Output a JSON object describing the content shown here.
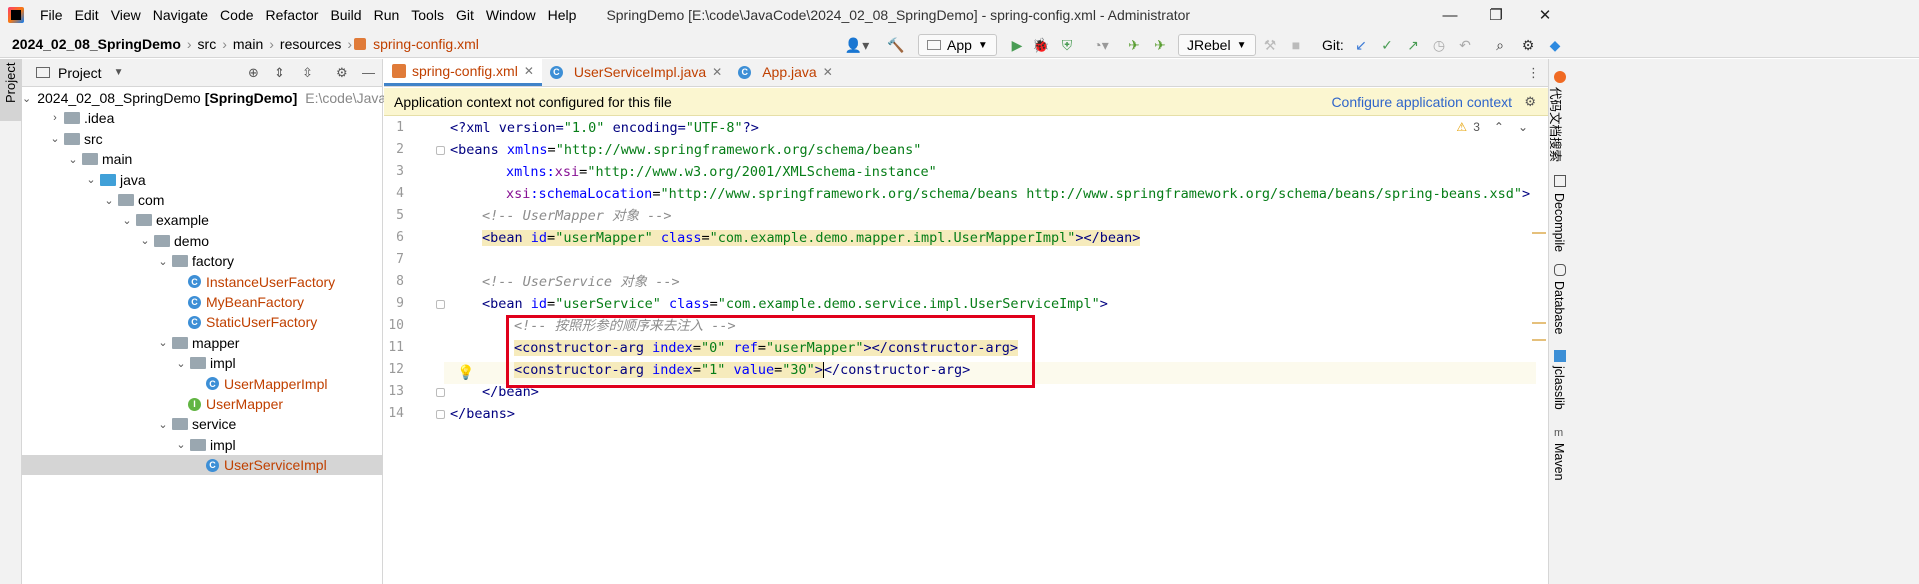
{
  "menubar": {
    "items": [
      "File",
      "Edit",
      "View",
      "Navigate",
      "Code",
      "Refactor",
      "Build",
      "Run",
      "Tools",
      "Git",
      "Window",
      "Help"
    ],
    "title": "SpringDemo [E:\\code\\JavaCode\\2024_02_08_SpringDemo] - spring-config.xml - Administrator"
  },
  "breadcrumb": [
    "2024_02_08_SpringDemo",
    "src",
    "main",
    "resources",
    "spring-config.xml"
  ],
  "toolbar": {
    "run_config": "App",
    "jrebel": "JRebel",
    "git_label": "Git:"
  },
  "left_strip": {
    "project_tab": "Project"
  },
  "project_panel": {
    "title": "Project",
    "tree": [
      {
        "label": "2024_02_08_SpringDemo",
        "bold": "[SpringDemo]",
        "path": "E:\\code\\Java",
        "depth": 0,
        "type": "module",
        "expanded": true
      },
      {
        "label": ".idea",
        "depth": 1,
        "type": "folder",
        "expanded": false
      },
      {
        "label": "src",
        "depth": 1,
        "type": "folder",
        "expanded": true
      },
      {
        "label": "main",
        "depth": 2,
        "type": "folder",
        "expanded": true
      },
      {
        "label": "java",
        "depth": 3,
        "type": "source",
        "expanded": true
      },
      {
        "label": "com",
        "depth": 4,
        "type": "folder",
        "expanded": true
      },
      {
        "label": "example",
        "depth": 5,
        "type": "folder",
        "expanded": true
      },
      {
        "label": "demo",
        "depth": 6,
        "type": "folder",
        "expanded": true
      },
      {
        "label": "factory",
        "depth": 7,
        "type": "folder",
        "expanded": true
      },
      {
        "label": "InstanceUserFactory",
        "depth": 8,
        "type": "class"
      },
      {
        "label": "MyBeanFactory",
        "depth": 8,
        "type": "class"
      },
      {
        "label": "StaticUserFactory",
        "depth": 8,
        "type": "class"
      },
      {
        "label": "mapper",
        "depth": 7,
        "type": "folder",
        "expanded": true
      },
      {
        "label": "impl",
        "depth": 8,
        "type": "folder",
        "expanded": true
      },
      {
        "label": "UserMapperImpl",
        "depth": 9,
        "type": "class"
      },
      {
        "label": "UserMapper",
        "depth": 8,
        "type": "interface"
      },
      {
        "label": "service",
        "depth": 7,
        "type": "folder",
        "expanded": true
      },
      {
        "label": "impl",
        "depth": 8,
        "type": "folder",
        "expanded": true
      },
      {
        "label": "UserServiceImpl",
        "depth": 9,
        "type": "class",
        "selected": true
      }
    ]
  },
  "editor": {
    "tabs": [
      {
        "label": "spring-config.xml",
        "active": true
      },
      {
        "label": "UserServiceImpl.java",
        "active": false
      },
      {
        "label": "App.java",
        "active": false
      }
    ],
    "banner_text": "Application context not configured for this file",
    "banner_link": "Configure application context",
    "warnings_count": "3",
    "line_numbers": [
      "1",
      "2",
      "3",
      "4",
      "5",
      "6",
      "7",
      "8",
      "9",
      "10",
      "11",
      "12",
      "13",
      "14"
    ]
  },
  "code": {
    "l1": [
      "<?xml version=",
      "\"1.0\"",
      " encoding=",
      "\"UTF-8\"",
      "?>"
    ],
    "l2": [
      "<beans ",
      "xmlns",
      "=",
      "\"http://www.springframework.org/schema/beans\""
    ],
    "l3": [
      "xmlns:",
      "xsi",
      "=",
      "\"http://www.w3.org/2001/XMLSchema-instance\""
    ],
    "l4": [
      "xsi",
      ":schemaLocation",
      "=",
      "\"http://www.springframework.org/schema/beans http://www.springframework.org/schema/beans/spring-beans.xsd\"",
      ">"
    ],
    "l5": "<!-- UserMapper 对象 -->",
    "l6": [
      "<bean ",
      "id",
      "=",
      "\"userMapper\"",
      " class",
      "=",
      "\"com.example.demo.mapper.impl.UserMapperImpl\"",
      "></bean>"
    ],
    "l8": "<!-- UserService 对象 -->",
    "l9": [
      "<bean ",
      "id",
      "=",
      "\"userService\"",
      " class",
      "=",
      "\"com.example.demo.service.impl.UserServiceImpl\"",
      ">"
    ],
    "l10": "<!-- 按照形参的顺序来去注入 -->",
    "l11": [
      "<constructor-arg ",
      "index",
      "=",
      "\"0\"",
      " ref",
      "=",
      "\"userMapper\"",
      "></constructor-arg>"
    ],
    "l12": [
      "<constructor-arg ",
      "index",
      "=",
      "\"1\"",
      " value",
      "=",
      "\"30\"",
      ">",
      "</constructor-arg>"
    ],
    "l13": "</bean>",
    "l14": "</beans>"
  },
  "right_strip": [
    "代码文档搜索",
    "Decompile",
    "Database",
    "jclasslib",
    "Maven"
  ]
}
